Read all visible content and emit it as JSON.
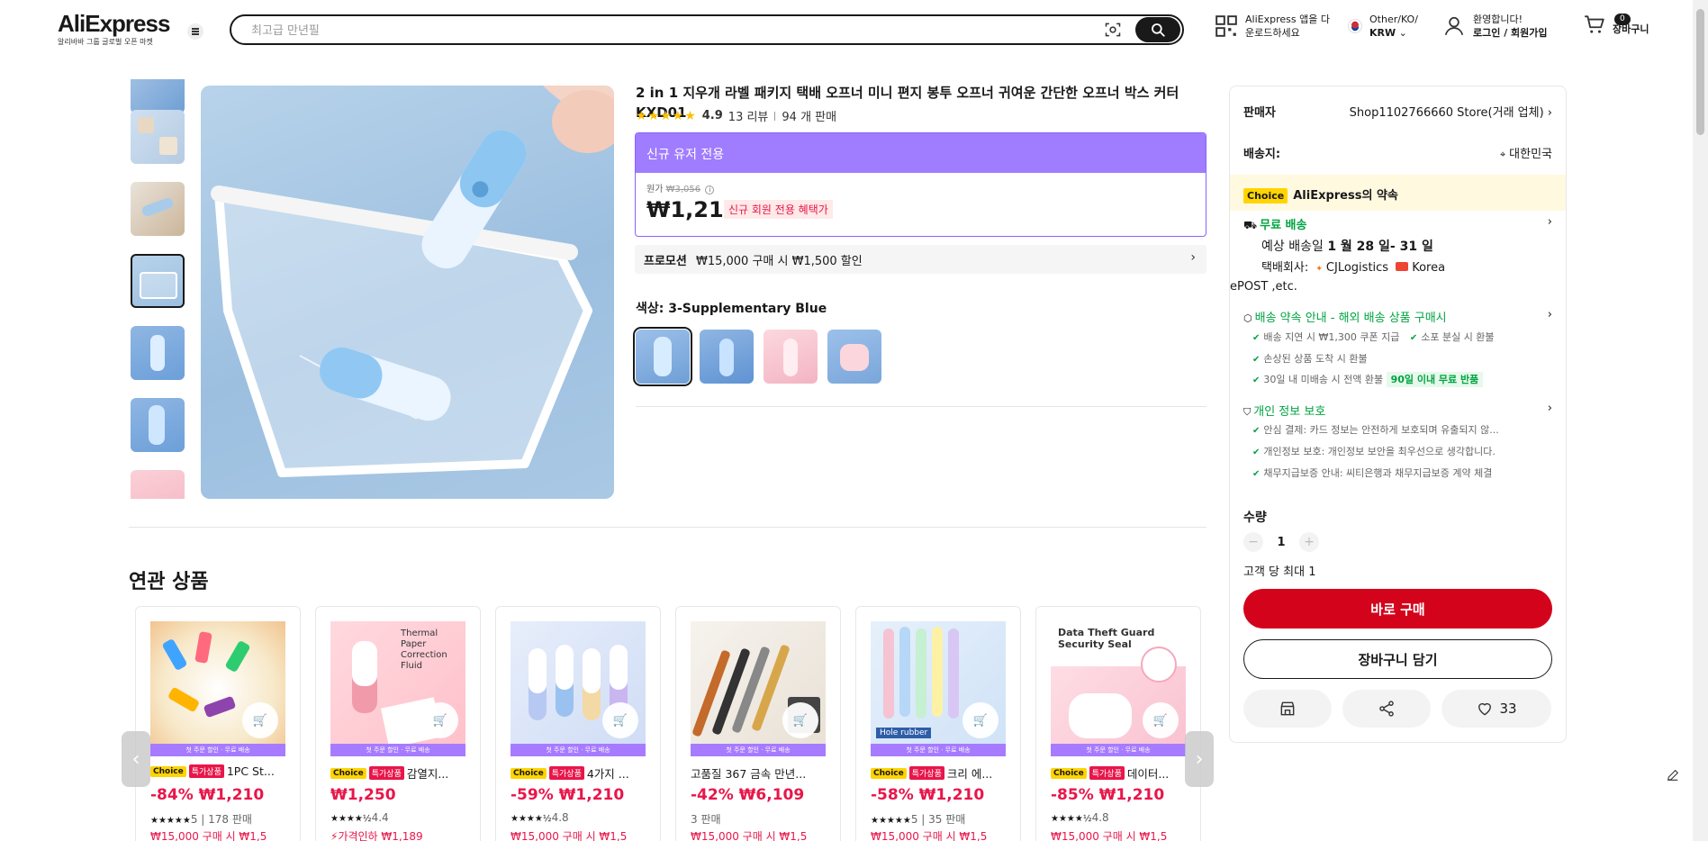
{
  "header": {
    "logo": "AliExpress",
    "logo_sub": "알리바바 그룹 글로벌 오픈 마켓",
    "search_placeholder": "최고급 만년필",
    "app_line1": "AliExpress 앱을 다",
    "app_line2": "운로드하세요",
    "region_line1": "Other/KO/",
    "region_line2": "KRW",
    "account_line1": "환영합니다!",
    "account_line2": "로그인 / 회원가입",
    "cart_count": "0",
    "cart_label": "장바구니"
  },
  "product": {
    "title": "2 in 1 지우개 라벨 패키지 택배 오프너 미니 편지 봉투 오프너 귀여운 간단한 오프너 박스 커터 KXD01",
    "stars": "★★★★★",
    "rating": "4.9",
    "reviews": "13 리뷰",
    "sold": "94 개 판매",
    "new_user_label": "신규 유저 전용",
    "orig_price_label": "원가",
    "orig_price": "₩3,056",
    "price": "₩1,210",
    "price_tag": "신규 회원 전용 혜택가",
    "promo_label": "프로모션",
    "promo_text": "₩15,000 구매 시 ₩1,500 할인",
    "color_label": "색상: 3-Supplementary Blue"
  },
  "panel": {
    "seller_label": "판매자",
    "seller_name": "Shop1102766660 Store(거래 업체)",
    "ship_to_label": "배송지:",
    "ship_to": "대한민국",
    "choice_chip": "Choice",
    "choice_text": "AliExpress의 약속",
    "free_ship": "무료 배송",
    "est_label": "예상 배송일",
    "est_date": "1 월 28 일- 31 일",
    "carrier_label": "택배회사:",
    "carrier1": "CJLogistics",
    "carrier2": "Korea",
    "carrier3": "ePOST ,etc.",
    "delivery_promise": "배송 약속 안내 - 해외 배송 상품 구매시",
    "dp1": "배송 지연 시 ₩1,300 쿠폰 지급",
    "dp2": "소포 분실 시 환불",
    "dp3": "손상된 상품 도착 시 환불",
    "dp4": "30일 내 미배송 시 전액 환불",
    "dp_chip": "90일 이내 무료 반품",
    "privacy": "개인 정보 보호",
    "pv1": "안심 결제: 카드 정보는 안전하게 보호되며 유출되지 않...",
    "pv2": "개인정보 보호: 개인정보 보안을 최우선으로 생각합니다.",
    "pv3": "채무지급보증 안내: 씨티은행과 채무지급보증 계약 체결",
    "qty_label": "수량",
    "qty_value": "1",
    "qty_limit": "고객 당 최대 1",
    "buy_now": "바로 구매",
    "add_cart": "장바구니 담기",
    "wish_count": "33"
  },
  "related": {
    "title": "연관 상품",
    "band_text": "첫 주문 할인 · 무료 배송",
    "items": [
      {
        "choice": "Choice",
        "sale": "특가상품",
        "name": "1PC St...",
        "discount": "-84%",
        "price": "₩1,210",
        "stars": "★★★★★",
        "rating": "5",
        "sold": "178 판매",
        "promo": "₩15,000 구매 시 ₩1,5"
      },
      {
        "choice": "Choice",
        "sale": "특가상품",
        "name": "감열지...",
        "discount": "",
        "price": "₩1,250",
        "stars": "★★★★½",
        "rating": "4.4",
        "sold": "",
        "promo": "가격인하 ₩1,189"
      },
      {
        "choice": "Choice",
        "sale": "특가상품",
        "name": "4가지 ...",
        "discount": "-59%",
        "price": "₩1,210",
        "stars": "★★★★½",
        "rating": "4.8",
        "sold": "",
        "promo": "₩15,000 구매 시 ₩1,5"
      },
      {
        "choice": "",
        "sale": "",
        "name": "고품질 367 금속 만년...",
        "discount": "-42%",
        "price": "₩6,109",
        "stars": "",
        "rating": "",
        "sold": "3 판매",
        "promo": "₩15,000 구매 시 ₩1,5"
      },
      {
        "choice": "Choice",
        "sale": "특가상품",
        "name": "크리 에...",
        "discount": "-58%",
        "price": "₩1,210",
        "stars": "★★★★★",
        "rating": "5",
        "sold": "35 판매",
        "promo": "₩15,000 구매 시 ₩1,5"
      },
      {
        "choice": "Choice",
        "sale": "특가상품",
        "name": "데이터...",
        "discount": "-85%",
        "price": "₩1,210",
        "stars": "★★★★½",
        "rating": "4.8",
        "sold": "",
        "promo": "₩15,000 구매 시 ₩1,5"
      }
    ],
    "card_images": {
      "img2_text1": "Thermal Paper",
      "img2_text2": "Correction Fluid",
      "img6_text1": "Data Theft Guard",
      "img6_text2": "Security Seal",
      "img5_text": "Hole rubber"
    }
  }
}
